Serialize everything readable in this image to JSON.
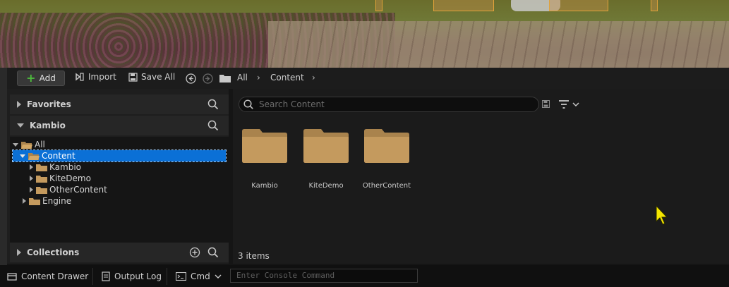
{
  "toolbar": {
    "add_label": "Add",
    "import_label": "Import",
    "save_all_label": "Save All",
    "breadcrumb": [
      "All",
      "Content"
    ]
  },
  "sidebar": {
    "favorites_label": "Favorites",
    "project_label": "Kambio",
    "collections_label": "Collections",
    "tree": [
      {
        "label": "All",
        "expanded": true,
        "selected": false
      },
      {
        "label": "Content",
        "expanded": true,
        "selected": true
      },
      {
        "label": "Kambio",
        "expanded": false,
        "selected": false
      },
      {
        "label": "KiteDemo",
        "expanded": false,
        "selected": false
      },
      {
        "label": "OtherContent",
        "expanded": false,
        "selected": false
      },
      {
        "label": "Engine",
        "expanded": false,
        "selected": false
      }
    ]
  },
  "main": {
    "search_placeholder": "Search Content",
    "folders": [
      "Kambio",
      "KiteDemo",
      "OtherContent"
    ],
    "item_count": "3 items"
  },
  "statusbar": {
    "content_drawer_label": "Content Drawer",
    "output_log_label": "Output Log",
    "cmd_label": "Cmd",
    "console_placeholder": "Enter Console Command"
  },
  "colors": {
    "selection": "#0b70d6",
    "folder": "#c49a5e",
    "add_accent": "#4dbb3d"
  }
}
